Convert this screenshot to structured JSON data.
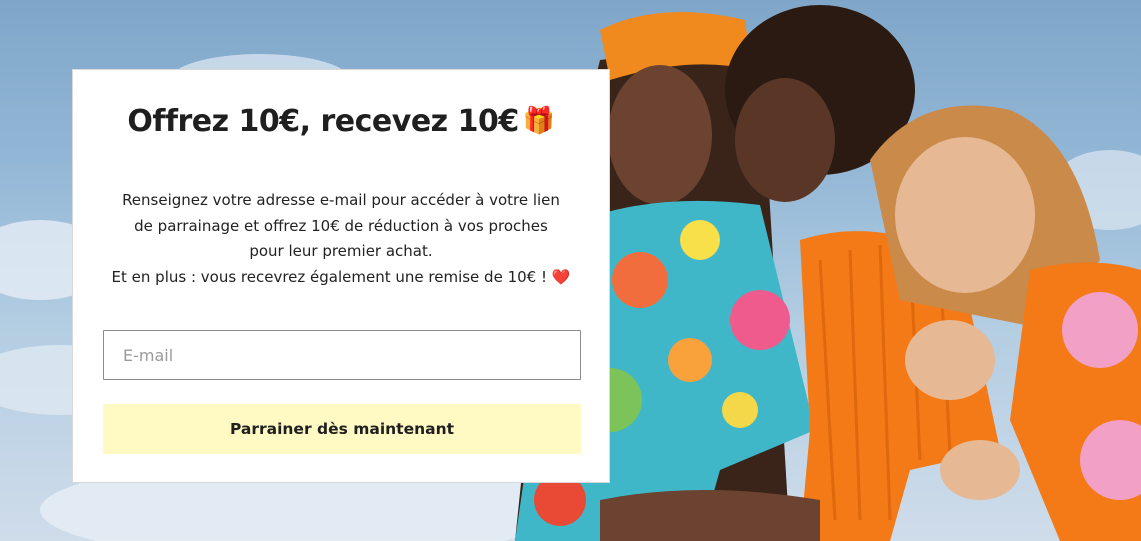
{
  "popup": {
    "title": "Offrez 10€, recevez 10€",
    "title_emoji": "🎁",
    "description_lines": [
      "Renseignez votre adresse e-mail pour accéder à votre lien",
      "de parrainage et offrez 10€ de réduction à vos proches",
      "pour leur premier achat.",
      "Et en plus : vous recevrez également une remise de 10€ !"
    ],
    "heart_emoji": "❤️",
    "email": {
      "placeholder": "E-mail",
      "value": ""
    },
    "cta_label": "Parrainer dès maintenant"
  },
  "colors": {
    "cta_background": "#fff9c4",
    "card_background": "#ffffff",
    "text": "#1f1f1f"
  }
}
